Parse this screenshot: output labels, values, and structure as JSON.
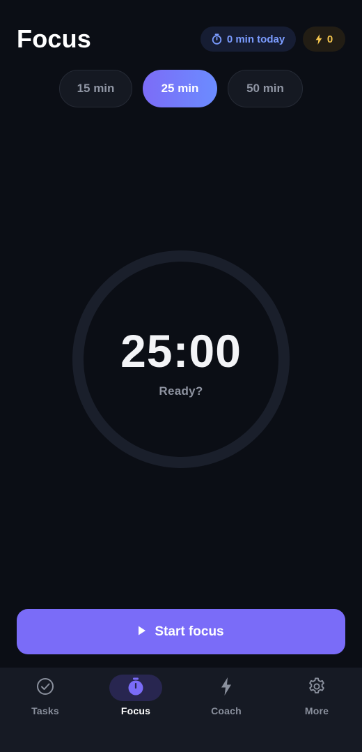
{
  "header": {
    "title": "Focus",
    "today_label": "0 min today",
    "streak_count": "0"
  },
  "durations": [
    {
      "label": "15 min",
      "selected": false
    },
    {
      "label": "25 min",
      "selected": true
    },
    {
      "label": "50 min",
      "selected": false
    }
  ],
  "timer": {
    "display": "25:00",
    "status": "Ready?",
    "progress": 0
  },
  "start_button": {
    "label": "Start focus"
  },
  "nav": {
    "items": [
      {
        "label": "Tasks",
        "icon": "check-circle-icon",
        "active": false
      },
      {
        "label": "Focus",
        "icon": "timer-icon",
        "active": true
      },
      {
        "label": "Coach",
        "icon": "bolt-icon",
        "active": false
      },
      {
        "label": "More",
        "icon": "gear-icon",
        "active": false
      }
    ]
  },
  "colors": {
    "background": "#0b0e15",
    "accent": "#7a6cf8",
    "accent_blue": "#6b8cff",
    "streak": "#f5c64e",
    "ring": "#1a1f2b"
  }
}
